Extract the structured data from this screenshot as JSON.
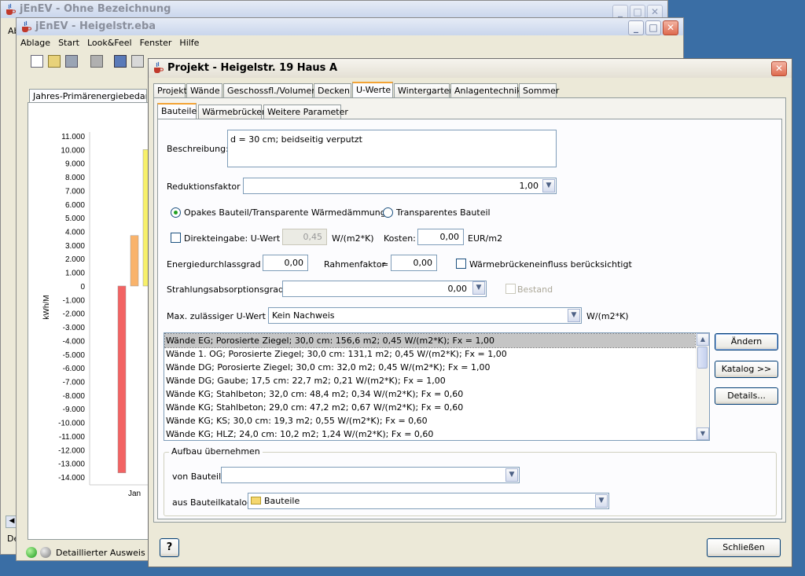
{
  "back_window": {
    "title": "jEnEV - Ohne Bezeichnung",
    "partial_label": "Ab",
    "bottom_partial": "De"
  },
  "main_window": {
    "title": "jEnEV - Heigelstr.eba",
    "menu": [
      "Ablage",
      "Start",
      "Look&Feel",
      "Fenster",
      "Hilfe"
    ],
    "tab_label": "Jahres-Primärenergiebedarf",
    "status_label": "Detaillierter Ausweis",
    "status_partial": "A"
  },
  "chart_data": {
    "type": "bar",
    "ylabel": "kWh/M",
    "yticks": [
      "11.000",
      "10.000",
      "9.000",
      "8.000",
      "7.000",
      "6.000",
      "5.000",
      "4.000",
      "3.000",
      "2.000",
      "1.000",
      "0",
      "-1.000",
      "-2.000",
      "-3.000",
      "-4.000",
      "-5.000",
      "-6.000",
      "-7.000",
      "-8.000",
      "-9.000",
      "-10.000",
      "-11.000",
      "-12.000",
      "-13.000",
      "-14.000"
    ],
    "ylim": [
      -14000,
      11000
    ],
    "categories": [
      "Jan"
    ],
    "series": [
      {
        "values": [
          -13700
        ],
        "color": "#f26363"
      },
      {
        "values": [
          3700
        ],
        "color": "#f9b36b"
      },
      {
        "values": [
          10000
        ],
        "color": "#f7f06a"
      }
    ]
  },
  "dialog": {
    "title": "Projekt - Heigelstr. 19 Haus A",
    "tabs": [
      "Projekt",
      "Wände",
      "Geschossfl./Volumen",
      "Decken",
      "U-Werte",
      "Wintergarten",
      "Anlagentechnik",
      "Sommer"
    ],
    "active_tab": "U-Werte",
    "subtabs": [
      "Bauteile",
      "Wärmebrücken",
      "Weitere Parameter"
    ],
    "beschreibung_label": "Beschreibung:",
    "beschreibung_value": "d = 30 cm; beidseitig verputzt",
    "reduktion_label": "Reduktionsfaktor =",
    "reduktion_value": "1,00",
    "radio_opak": "Opakes Bauteil/Transparente Wärmedämmung",
    "radio_transparent": "Transparentes Bauteil",
    "direkt_label": "Direkteingabe: U-Wert =",
    "direkt_value": "0,45",
    "direkt_unit": "W/(m2*K)",
    "kosten_label": "Kosten:",
    "kosten_value": "0,00",
    "kosten_unit": "EUR/m2",
    "energie_label": "Energiedurchlassgrad =",
    "energie_value": "0,00",
    "rahmen_label": "Rahmenfaktor",
    "rahmen_eq": "=",
    "rahmen_value": "0,00",
    "waermebruecken_label": "Wärmebrückeneinfluss berücksichtigt",
    "strahlung_label": "Strahlungsabsorptionsgrad =",
    "strahlung_value": "0,00",
    "bestand_label": "Bestand",
    "maxu_label": "Max. zulässiger U-Wert =",
    "maxu_value": "Kein Nachweis",
    "maxu_unit": "W/(m2*K)",
    "bauteile": [
      "Wände EG; Porosierte Ziegel; 30,0 cm: 156,6 m2; 0,45 W/(m2*K); Fx = 1,00",
      "Wände 1. OG; Porosierte Ziegel; 30,0 cm: 131,1 m2; 0,45 W/(m2*K); Fx = 1,00",
      "Wände DG; Porosierte Ziegel; 30,0 cm: 32,0 m2; 0,45 W/(m2*K); Fx = 1,00",
      "Wände DG; Gaube; 17,5 cm: 22,7 m2; 0,21 W/(m2*K); Fx = 1,00",
      "Wände KG; Stahlbeton; 32,0 cm: 48,4 m2; 0,34 W/(m2*K); Fx = 0,60",
      "Wände KG; Stahlbeton; 29,0 cm: 47,2 m2; 0,67 W/(m2*K); Fx = 0,60",
      "Wände KG; KS; 30,0 cm: 19,3 m2; 0,55 W/(m2*K); Fx = 0,60",
      "Wände KG; HLZ; 24,0 cm: 10,2 m2; 1,24 W/(m2*K); Fx = 0,60"
    ],
    "btn_aendern": "Ändern",
    "btn_katalog": "Katalog >>",
    "btn_details": "Details...",
    "aufbau_title": "Aufbau übernehmen",
    "von_bauteil_label": "von Bauteil:",
    "von_bauteil_value": "",
    "katalog_label": "aus Bauteilkatalog:",
    "katalog_value": "Bauteile",
    "help_label": "?",
    "close_label": "Schließen"
  }
}
